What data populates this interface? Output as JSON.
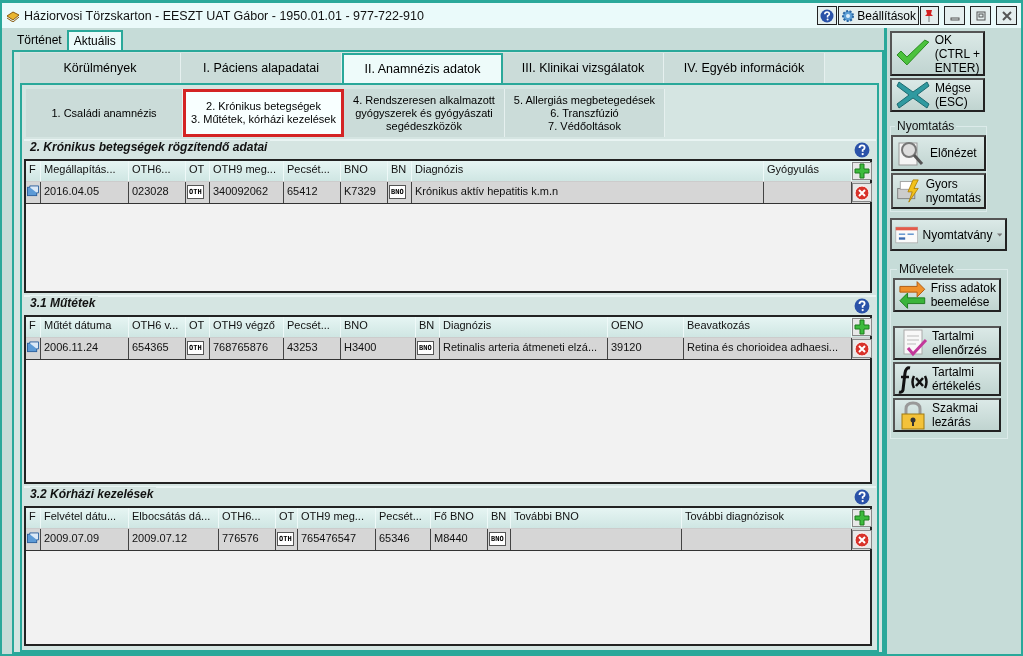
{
  "window": {
    "title": "Háziorvosi Törzskarton - EESZT UAT Gábor - 1950.01.01 - 977-722-910",
    "settings": "Beállítások"
  },
  "history_tabs": [
    {
      "label": "Történet",
      "selected": false
    },
    {
      "label": "Aktuális",
      "selected": true
    }
  ],
  "main_tabs": [
    {
      "label": "Körülmények",
      "selected": false
    },
    {
      "label": "I. Páciens alapadatai",
      "selected": false
    },
    {
      "label": "II. Anamnézis adatok",
      "selected": true
    },
    {
      "label": "III. Klinikai vizsgálatok",
      "selected": false
    },
    {
      "label": "IV. Egyéb információk",
      "selected": false
    }
  ],
  "sub_tabs": [
    {
      "lines": [
        "1. Családi anamnézis"
      ],
      "selected": false
    },
    {
      "lines": [
        "2. Krónikus betegségek",
        "3. Műtétek, kórházi kezelések"
      ],
      "selected": true
    },
    {
      "lines": [
        "4. Rendszeresen alkalmazott",
        "gyógyszerek és gyógyászati",
        "segédeszközök"
      ],
      "selected": false
    },
    {
      "lines": [
        "5. Allergiás megbetegedések",
        "6. Transzfúzió",
        "7. Védőoltások"
      ],
      "selected": false
    }
  ],
  "sections": [
    {
      "title": "2. Krónikus betegségek rögzítendő adatai",
      "columns": [
        "F",
        "Megállapítás...",
        "OTH6...",
        "OT",
        "OTH9 meg...",
        "Pecsét...",
        "BNO",
        "BN",
        "Diagnózis",
        "Gyógyulás"
      ],
      "rows": [
        {
          "cells": [
            {
              "kind": "icon"
            },
            {
              "kind": "text",
              "text": "2016.04.05"
            },
            {
              "kind": "text",
              "text": "023028"
            },
            {
              "kind": "button",
              "text": "OTH"
            },
            {
              "kind": "text",
              "text": "340092062"
            },
            {
              "kind": "text",
              "text": "65412"
            },
            {
              "kind": "text",
              "text": "K7329"
            },
            {
              "kind": "button",
              "text": "BNO"
            },
            {
              "kind": "text",
              "text": "Krónikus aktív hepatitis k.m.n"
            },
            {
              "kind": "empty"
            }
          ]
        }
      ]
    },
    {
      "title": "3.1 Műtétek",
      "columns": [
        "F",
        "Műtét dátuma",
        "OTH6 v...",
        "OT",
        "OTH9 végző",
        "Pecsét...",
        "BNO",
        "BN",
        "Diagnózis",
        "OENO",
        "Beavatkozás"
      ],
      "rows": [
        {
          "cells": [
            {
              "kind": "icon"
            },
            {
              "kind": "text",
              "text": "2006.11.24"
            },
            {
              "kind": "text",
              "text": "654365"
            },
            {
              "kind": "button",
              "text": "OTH"
            },
            {
              "kind": "text",
              "text": "768765876"
            },
            {
              "kind": "text",
              "text": "43253"
            },
            {
              "kind": "text",
              "text": "H3400"
            },
            {
              "kind": "button",
              "text": "BNO"
            },
            {
              "kind": "text",
              "text": "Retinalis arteria átmeneti elzá..."
            },
            {
              "kind": "text",
              "text": "39120"
            },
            {
              "kind": "text",
              "text": "Retina és chorioidea adhaesi..."
            }
          ]
        }
      ]
    },
    {
      "title": "3.2 Kórházi kezelések",
      "columns": [
        "F",
        "Felvétel dátu...",
        "Elbocsátás dá...",
        "OTH6...",
        "OT",
        "OTH9 meg...",
        "Pecsét...",
        "Fő BNO",
        "BN",
        "További BNO",
        "További diagnózisok"
      ],
      "rows": [
        {
          "cells": [
            {
              "kind": "icon"
            },
            {
              "kind": "text",
              "text": "2009.07.09"
            },
            {
              "kind": "text",
              "text": "2009.07.12"
            },
            {
              "kind": "text",
              "text": "776576"
            },
            {
              "kind": "button",
              "text": "OTH"
            },
            {
              "kind": "text",
              "text": "765476547"
            },
            {
              "kind": "text",
              "text": "65346"
            },
            {
              "kind": "text",
              "text": "M8440"
            },
            {
              "kind": "button",
              "text": "BNO"
            },
            {
              "kind": "empty"
            },
            {
              "kind": "empty"
            }
          ]
        }
      ]
    }
  ],
  "main_buttons": [
    {
      "kind": "ok",
      "lines": [
        "OK",
        "(CTRL +",
        "ENTER)"
      ]
    },
    {
      "kind": "cancel",
      "lines": [
        "Mégse",
        "(ESC)"
      ]
    }
  ],
  "print_group": {
    "label": "Nyomtatás",
    "buttons": [
      {
        "kind": "preview",
        "lines": [
          "Előnézet"
        ]
      },
      {
        "kind": "quickprint",
        "lines": [
          "Gyors",
          "nyomtatás"
        ]
      }
    ]
  },
  "form_button": {
    "label": "Nyomtatvány"
  },
  "operations": {
    "label": "Műveletek",
    "buttons": [
      {
        "kind": "import",
        "lines": [
          "Friss adatok",
          "beemelése"
        ]
      },
      {
        "kind": "check",
        "lines": [
          "Tartalmi",
          "ellenőrzés"
        ]
      },
      {
        "kind": "evaluate",
        "lines": [
          "Tartalmi",
          "értékelés"
        ]
      },
      {
        "kind": "lock",
        "lines": [
          "Szakmai",
          "lezárás"
        ]
      }
    ]
  }
}
